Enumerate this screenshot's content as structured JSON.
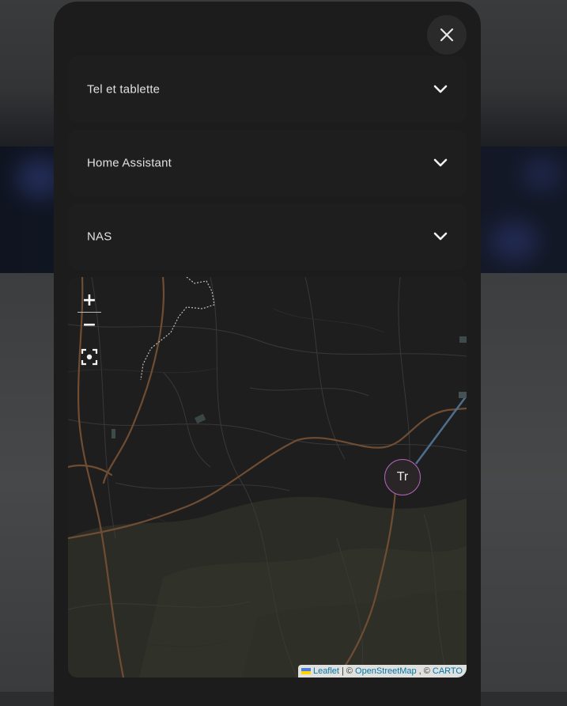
{
  "dialog": {
    "close_icon": "close-icon",
    "panels": [
      {
        "label": "Tel et tablette",
        "icon": "chevron-down-icon"
      },
      {
        "label": "Home Assistant",
        "icon": "chevron-down-icon"
      },
      {
        "label": "NAS",
        "icon": "chevron-down-icon"
      }
    ]
  },
  "map": {
    "zoom_in_label": "+",
    "zoom_out_label": "−",
    "locate_icon": "locate-icon",
    "marker_label": "Tr",
    "marker_color": "#b064b8",
    "attribution": {
      "leaflet": "Leaflet",
      "sep1": " | © ",
      "osm": "OpenStreetMap",
      "sep2": ", © ",
      "carto": "CARTO"
    }
  }
}
